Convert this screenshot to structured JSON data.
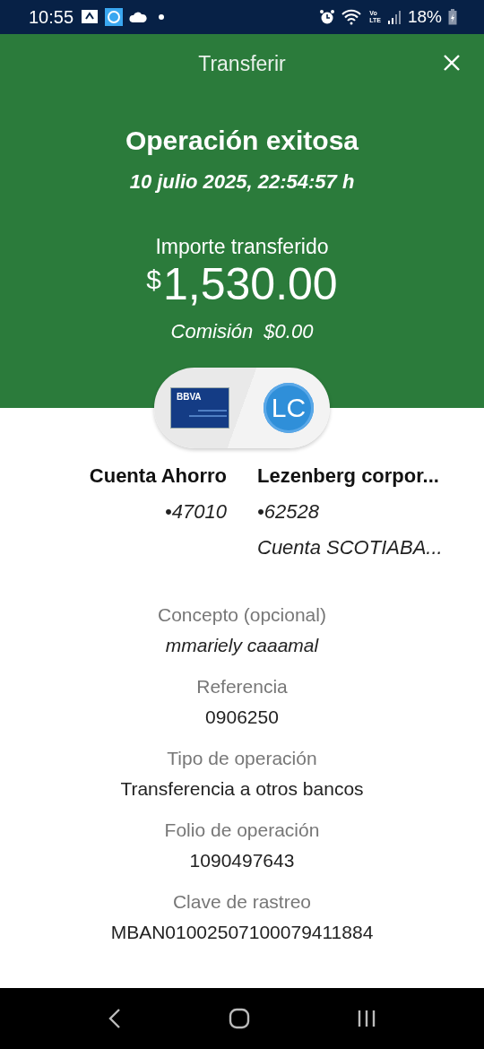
{
  "status_bar": {
    "time": "10:55",
    "network": [
      "Vo",
      "LTE"
    ],
    "battery": "18%"
  },
  "header": {
    "title": "Transferir"
  },
  "result": {
    "title": "Operación exitosa",
    "date": "10 julio 2025, 22:54:57 h",
    "amount_label": "Importe transferido",
    "currency": "$",
    "amount": "1,530.00",
    "fee_label": "Comisión",
    "fee": "$0.00"
  },
  "transfer": {
    "from_card_brand": "BBVA",
    "to_initials": "LC"
  },
  "accounts": [
    {
      "name": "Cuenta Ahorro",
      "number": "•47010"
    },
    {
      "name": "Lezenberg corpor...",
      "number": "•62528",
      "bank": "Cuenta SCOTIABA..."
    }
  ],
  "details": [
    {
      "label": "Concepto (opcional)",
      "value": "mmariely caaamal",
      "italic": true
    },
    {
      "label": "Referencia",
      "value": "0906250",
      "italic": false
    },
    {
      "label": "Tipo de operación",
      "value": "Transferencia a otros bancos",
      "italic": false
    },
    {
      "label": "Folio de operación",
      "value": "1090497643",
      "italic": false
    },
    {
      "label": "Clave de rastreo",
      "value": "MBAN01002507100079411884",
      "italic": false
    }
  ]
}
